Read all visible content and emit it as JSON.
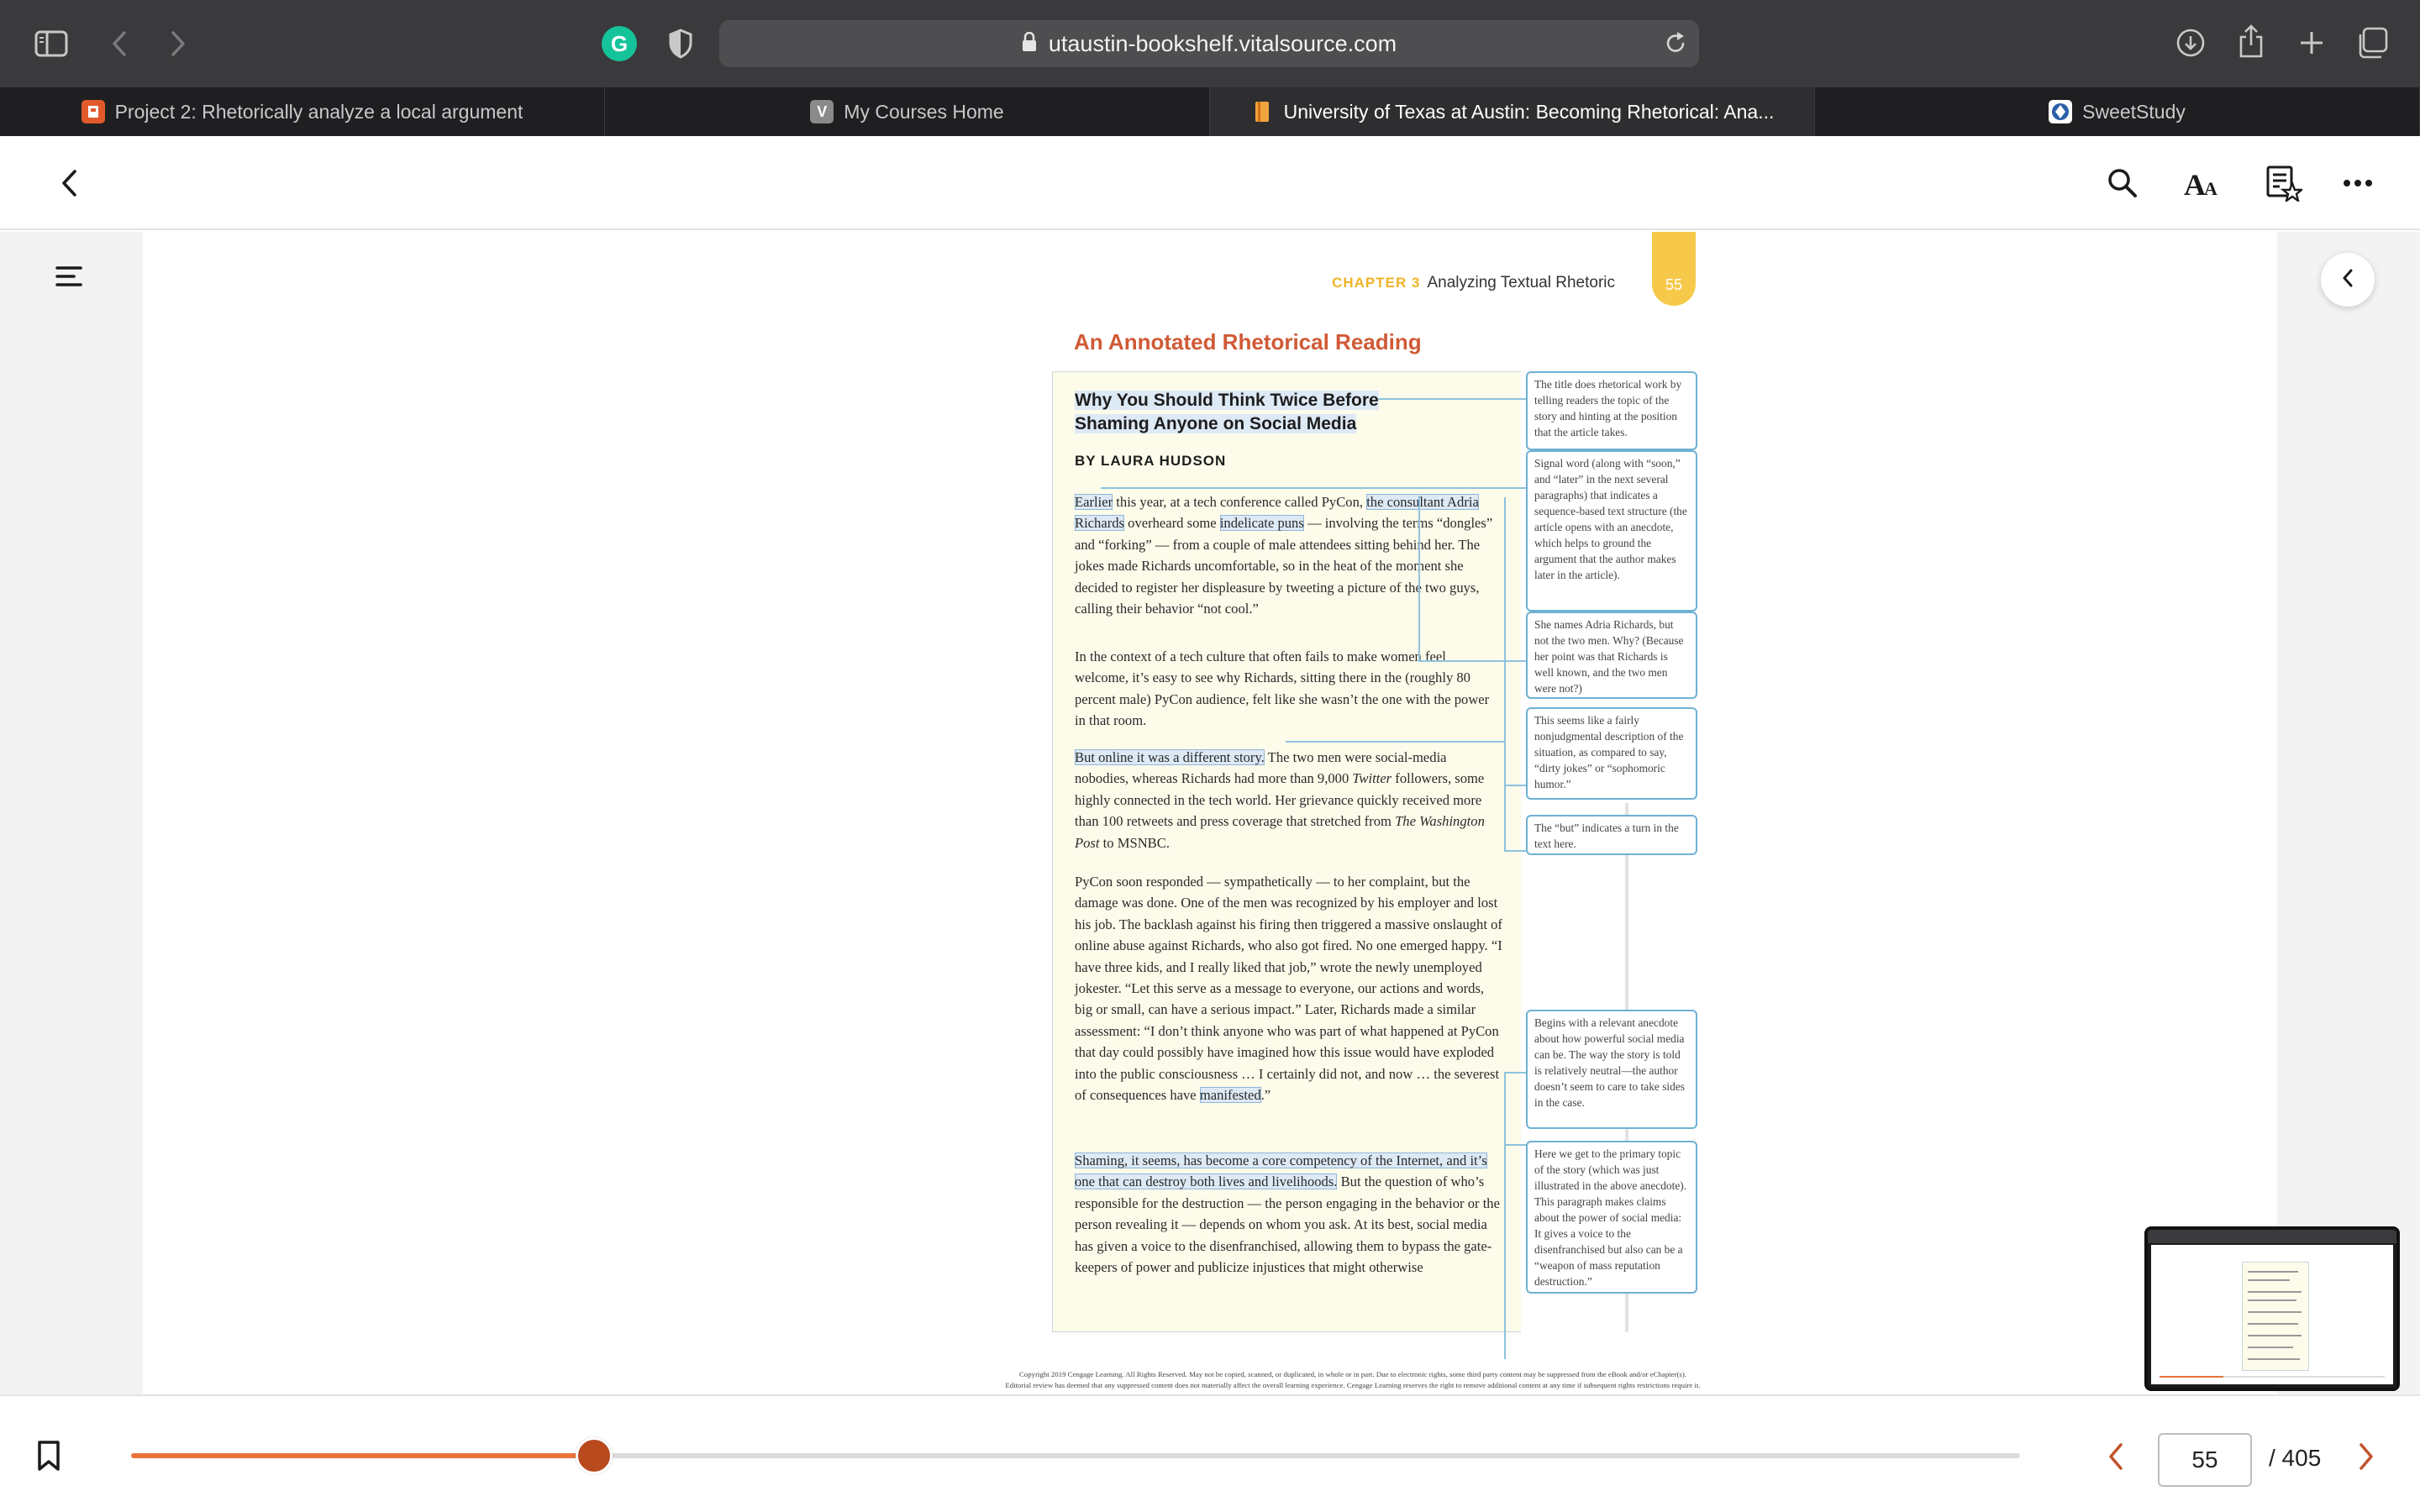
{
  "browser": {
    "url": "utaustin-bookshelf.vitalsource.com",
    "tabs": [
      {
        "label": "Project 2: Rhetorically analyze a local argument",
        "favicon_color": "#e05a2b",
        "favicon_glyph": "",
        "active": false
      },
      {
        "label": "My Courses Home",
        "favicon_color": "#8a8a8a",
        "favicon_glyph": "V",
        "active": false
      },
      {
        "label": "University of Texas at Austin: Becoming Rhetorical: Ana...",
        "favicon_color": "#f0a43b",
        "favicon_glyph": "",
        "active": true
      },
      {
        "label": "SweetStudy",
        "favicon_color": "#2a5fa8",
        "favicon_glyph": "",
        "active": false
      }
    ],
    "icons": [
      "sidebar-icon",
      "back-icon",
      "forward-icon",
      "grammarly-icon",
      "shield-icon",
      "lock-icon",
      "reload-icon",
      "download-icon",
      "share-icon",
      "new-tab-icon",
      "tab-overview-icon"
    ],
    "grammarly_glyph": "G"
  },
  "reader": {
    "header_icons": [
      "back-icon",
      "search-icon",
      "text-size-icon",
      "bookmarks-icon",
      "more-icon"
    ],
    "text_size_glyph": "AA"
  },
  "book": {
    "running_head": {
      "chapter": "CHAPTER 3",
      "title": "Analyzing Textual Rhetoric",
      "page": "55"
    },
    "section_title": "An Annotated Rhetorical Reading",
    "article": {
      "title_line1": "Why You Should Think Twice Before",
      "title_line2": "Shaming Anyone on Social Media",
      "byline": "BY LAURA HUDSON",
      "p1": {
        "hl1": "Earlier",
        "t1": " this year, at a tech conference called PyCon, ",
        "hl2": "the consultant Adria Richards",
        "t2": " overheard some ",
        "hl3": "indelicate puns",
        "t3": " — involving the terms “dongles” and “forking” — from a couple of male attendees sitting behind her. The jokes made Richards uncomfortable, so in the heat of the moment she decided to register her displeasure by tweeting a picture of the two guys, calling their behavior “not cool.”"
      },
      "p2": "In the context of a tech culture that often fails to make women feel welcome, it’s easy to see why Richards, sitting there in the (roughly 80 percent male) PyCon audience, felt like she wasn’t the one with the power in that room.",
      "p3": {
        "hl": "But online it was a different story.",
        "t1": " The two men were social-media nobodies, whereas Richards had more than 9,000 ",
        "i1": "Twitter",
        "t2": " followers, some highly connected in the tech world. Her grievance quickly received more than 100 retweets and press coverage that stretched from ",
        "i2": "The Washington Post",
        "t3": " to MSNBC."
      },
      "p4": {
        "t1": "PyCon soon responded — sympathetically — to her complaint, but the damage was done. One of the men was recognized by his employer and lost his job. The backlash against his firing then triggered a massive onslaught of online abuse against Richards, who also got fired. No one emerged happy. “I have three kids, and I really liked that job,” wrote the newly unemployed jokester. “Let this serve as a message to everyone, our actions and words, big or small, can have a serious impact.” Later, Richards made a similar assessment: “I don’t think anyone who was part of what happened at PyCon that day could possibly have imagined how this issue would have exploded into the public consciousness … I certainly did not, and now … the severest of consequences have ",
        "hl": "manifested",
        "t2": ".”"
      },
      "p5": {
        "hl": "Shaming, it seems, has become a core competency of the Internet, and it’s one that can destroy both lives and livelihoods.",
        "t1": " But the question of who’s responsible for the destruction — the person engaging in the behavior or the person revealing it — depends on whom you ask. At its best, social media has given a voice to the disenfranchised, allowing them to bypass the gate-keepers of power and publicize injustices that might otherwise"
      }
    },
    "annotations": [
      "The title does rhetorical work by telling readers the topic of the story and hinting at the position that the article takes.",
      "Signal word (along with “soon,” and “later” in the next several paragraphs) that indicates a sequence-based text structure (the article opens with an anecdote, which helps to ground the argument that the author makes later in the article).",
      "She names Adria Richards, but not the two men. Why? (Because her point was that Richards is well known, and the two men were not?)",
      "This seems like a fairly nonjudgmental description of the situation, as compared to say, “dirty jokes” or “sophomoric humor.”",
      "The “but” indicates a turn in the text here.",
      "Begins with a relevant anecdote about how powerful social media can be. The way the story is told is relatively neutral—the author doesn’t seem to care to take sides in the case.",
      "Here we get to the primary topic of the story (which was just illustrated in the above anecdote). This paragraph makes claims about the power of social media: It gives a voice to the disenfranchised but also can be a “weapon of mass reputation destruction.”"
    ],
    "copyright_line1": "Copyright 2019 Cengage Learning. All Rights Reserved. May not be copied, scanned, or duplicated, in whole or in part. Due to electronic rights, some third party content may be suppressed from the eBook and/or eChapter(s).",
    "copyright_line2": "Editorial review has deemed that any suppressed content does not materially affect the overall learning experience. Cengage Learning reserves the right to remove additional content at any time if subsequent rights restrictions require it."
  },
  "navigation": {
    "current_page": "55",
    "total_pages": "/ 405",
    "progress": 0.245,
    "accent_color": "#e8743b",
    "thumb_color": "#b84a1e"
  },
  "colors": {
    "toolbar": "#3a3a3c",
    "tabbar": "#1f1f21",
    "section_title": "#d05a36",
    "chapter_label": "#f0b429",
    "highlight": "#dde9f5",
    "annotation_border": "#6fb1d3"
  }
}
